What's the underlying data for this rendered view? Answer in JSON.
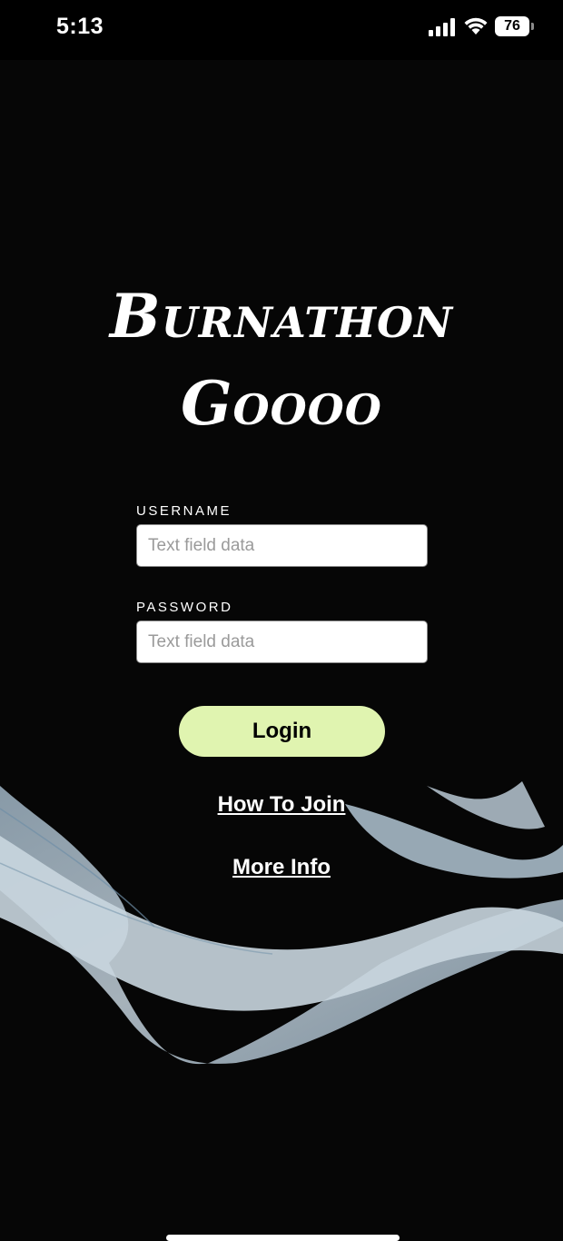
{
  "status_bar": {
    "time": "5:13",
    "battery_level": "76",
    "icons": [
      "signal-icon",
      "wifi-icon",
      "battery-icon"
    ]
  },
  "app": {
    "title_line1": "Burnathon",
    "title_line2": "Goooo"
  },
  "login_form": {
    "username_label": "USERNAME",
    "username_placeholder": "Text field data",
    "username_value": "",
    "password_label": "PASSWORD",
    "password_placeholder": "Text field data",
    "password_value": "",
    "login_label": "Login"
  },
  "links": {
    "how_to_join": "How To Join",
    "more_info": "More Info"
  },
  "colors": {
    "background": "#060606",
    "button_accent": "#e0f4b0",
    "wave": "#b4c6d2"
  }
}
